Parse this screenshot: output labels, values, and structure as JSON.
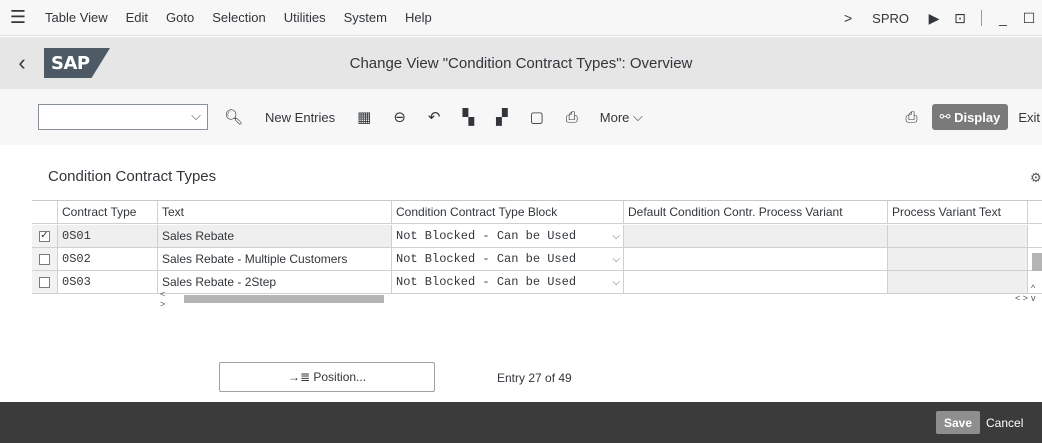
{
  "menubar": {
    "items": [
      "Table View",
      "Edit",
      "Goto",
      "Selection",
      "Utilities",
      "System",
      "Help"
    ],
    "tcode": "SPRO"
  },
  "header": {
    "title": "Change View \"Condition Contract Types\": Overview",
    "logo": "SAP"
  },
  "toolbar": {
    "command_value": "",
    "new_entries": "New Entries",
    "more": "More",
    "display": "Display",
    "exit": "Exit"
  },
  "section": {
    "title": "Condition Contract Types"
  },
  "table": {
    "columns": [
      "Contract Type",
      "Text",
      "Condition Contract Type Block",
      "Default Condition Contr. Process Variant",
      "Process Variant Text"
    ],
    "rows": [
      {
        "selected": "✓",
        "type": "0S01",
        "text": "Sales Rebate",
        "block": "Not Blocked - Can be Used",
        "variant": "",
        "variant_text": ""
      },
      {
        "selected": "",
        "type": "0S02",
        "text": "Sales Rebate - Multiple Customers",
        "block": "Not Blocked - Can be Used",
        "variant": "",
        "variant_text": ""
      },
      {
        "selected": "",
        "type": "0S03",
        "text": "Sales Rebate - 2Step",
        "block": "Not Blocked - Can be Used",
        "variant": "",
        "variant_text": ""
      }
    ]
  },
  "position": {
    "label": "Position...",
    "entry": "Entry 27 of 49"
  },
  "footer": {
    "save": "Save",
    "cancel": "Cancel"
  },
  "colors": {
    "shell": "#e6e6e6",
    "footer": "#3b3b3b",
    "display_button": "#7a7a7a"
  }
}
